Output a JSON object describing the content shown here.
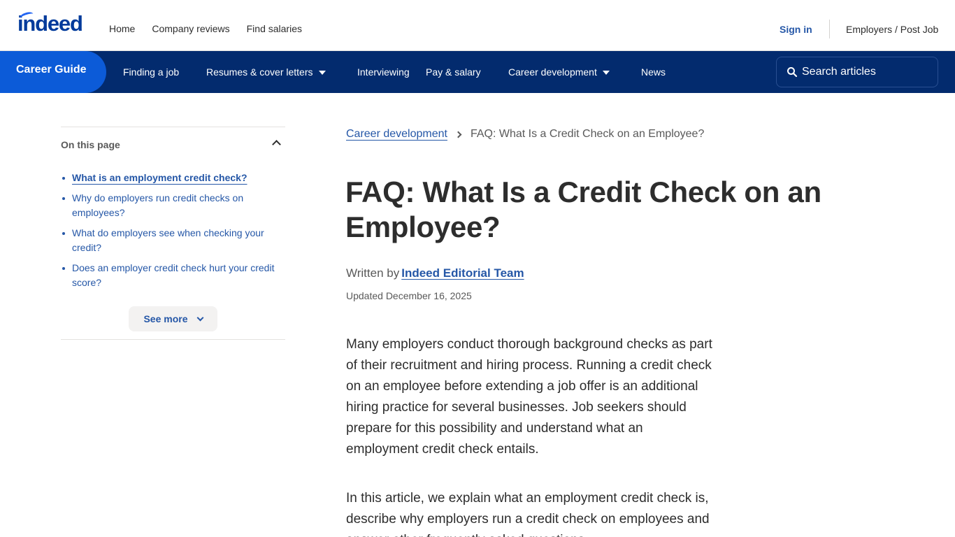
{
  "header": {
    "logo": "indeed",
    "nav": [
      "Home",
      "Company reviews",
      "Find salaries"
    ],
    "sign_in": "Sign in",
    "employers": "Employers / Post Job"
  },
  "career_nav": {
    "brand": "Career Guide",
    "items": [
      {
        "label": "Finding a job",
        "has_dropdown": false
      },
      {
        "label": "Resumes & cover letters",
        "has_dropdown": true
      },
      {
        "label": "Interviewing",
        "has_dropdown": false
      },
      {
        "label": "Pay & salary",
        "has_dropdown": false
      },
      {
        "label": "Career development",
        "has_dropdown": true
      },
      {
        "label": "News",
        "has_dropdown": false
      }
    ],
    "search_placeholder": "Search articles"
  },
  "toc": {
    "heading": "On this page",
    "items": [
      "What is an employment credit check?",
      "Why do employers run credit checks on employees?",
      "What do employers see when checking your credit?",
      "Does an employer credit check hurt your credit score?"
    ],
    "see_more": "See more"
  },
  "article": {
    "breadcrumb_parent": "Career development",
    "breadcrumb_current": "FAQ: What Is a Credit Check on an Employee?",
    "title": "FAQ: What Is a Credit Check on an Employee?",
    "written_by": "Written by",
    "author": "Indeed Editorial Team",
    "updated": "Updated December 16, 2025",
    "paragraphs": [
      "Many employers conduct thorough background checks as part of their recruitment and hiring process. Running a credit check on an employee before extending a job offer is an additional hiring practice for several businesses. Job seekers should prepare for this possibility and understand what an employment credit check entails.",
      "In this article, we explain what an employment credit check is, describe why employers run a credit check on employees and answer other frequently asked questions."
    ]
  },
  "colors": {
    "brand_blue": "#2557a7",
    "nav_bg": "#032b6e",
    "career_guide_bg": "#0c5bd8",
    "logo_blue": "#003a9b"
  }
}
